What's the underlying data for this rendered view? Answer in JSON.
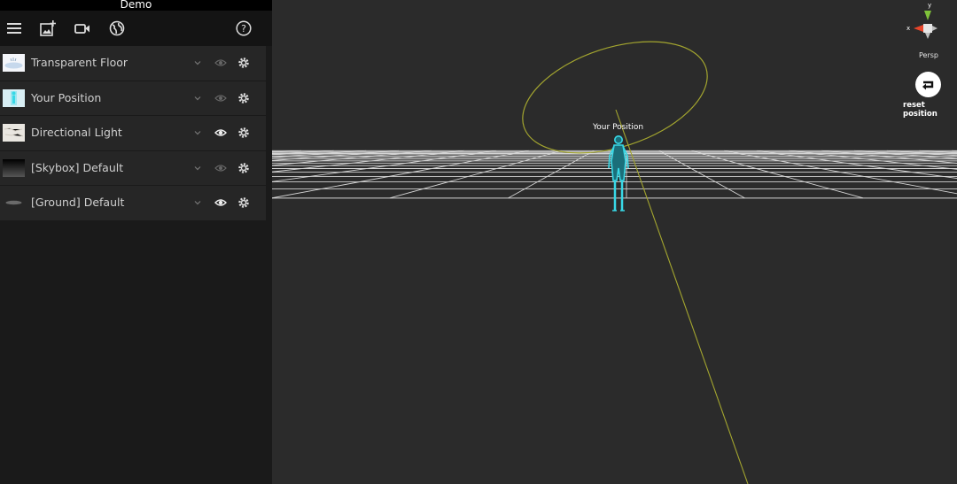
{
  "app": {
    "title": "Demo"
  },
  "toolbar": {
    "icons": [
      "menu-icon",
      "add-image-icon",
      "video-camera-icon",
      "globe-icon",
      "help-icon"
    ]
  },
  "layers": [
    {
      "label": "Transparent Floor",
      "visible": false
    },
    {
      "label": "Your Position",
      "visible": false
    },
    {
      "label": "Directional Light",
      "visible": true
    },
    {
      "label": "[Skybox] Default",
      "visible": false
    },
    {
      "label": "[Ground] Default",
      "visible": true
    }
  ],
  "viewport": {
    "object_label": "Your Position",
    "gizmo": {
      "y_axis_label": "y",
      "x_axis_label": "x",
      "view_mode": "Persp"
    },
    "reset_label": "reset position"
  },
  "colors": {
    "accent_figure": "#38d8e6",
    "light_ring": "#a3a52f",
    "grid_line": "#d4d4d4",
    "axis_y": "#7fc23a",
    "axis_x": "#e8452a"
  }
}
